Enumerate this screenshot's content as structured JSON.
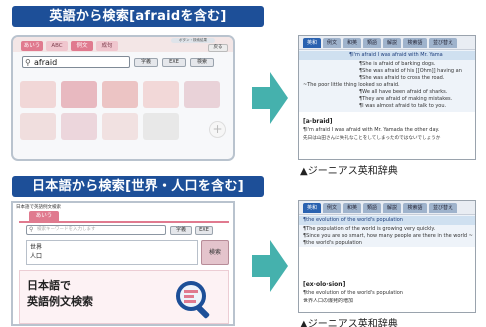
{
  "section1": {
    "heading": "英語から検索[afraidを含む]",
    "search_app": {
      "tabs": [
        "あいう",
        "ABC",
        "例文",
        "成句"
      ],
      "right_tab": "戻る",
      "top_pill": "ボタン・検索結果",
      "search_value": "afraid",
      "buttons": [
        "字義",
        "EXE",
        "検索"
      ]
    },
    "result": {
      "tabs": [
        "英和",
        "例文",
        "和英",
        "類語",
        "解説",
        "検索語",
        "並び替え"
      ],
      "result_lines": [
        "¶I'm afraid I was afraid with Mr. Yama",
        "¶She is afraid of barking dogs.",
        "¶She was afraid of his [[Ohm]] having an",
        "¶She was afraid to cross the road.",
        "~The poor little thing looked so afraid.",
        "¶We all have been afraid of sharks.",
        "¶They are afraid of making mistakes.",
        "¶I was almost afraid to talk to you."
      ],
      "entry_word": "[a·braid]",
      "entry_lines": [
        "¶I'm afraid I was afraid with Mr. Yamada the other day.",
        "先日は山田さんに失礼なことをしてしまったのではないでしょうか"
      ]
    },
    "caption": "▲ジーニアス英和辞典"
  },
  "section2": {
    "heading": "日本語から検索[世界・人口を含む]",
    "search_app": {
      "window_title": "日本語で英語例文検索",
      "tab": "あいう",
      "placeholder": "検索キーワードを入力します",
      "buttons": [
        "字義",
        "EXE"
      ],
      "field_labels": [
        "世界",
        "人口"
      ],
      "search_button": "検索",
      "logo_line1": "日本語で",
      "logo_line2": "英語例文検索"
    },
    "result": {
      "tabs": [
        "英和",
        "例文",
        "和英",
        "類語",
        "解説",
        "検索語",
        "並び替え"
      ],
      "result_lines": [
        "¶the evolution of the world's population",
        "¶The population of the world is growing very quickly.",
        "¶Since you are so smart, how many people are there in the world ~",
        "¶the world's population"
      ],
      "entry_word": "[ex·olo·sion]",
      "entry_lines": [
        "¶the evolution of the world's population",
        "世界人口の爆発的増加"
      ]
    },
    "caption": "▲ジーニアス英和辞典"
  },
  "colors": {
    "header_bg": "#1d4f98",
    "arrow": "#45b1ad",
    "highlight_bar": "#cfe0f0"
  }
}
